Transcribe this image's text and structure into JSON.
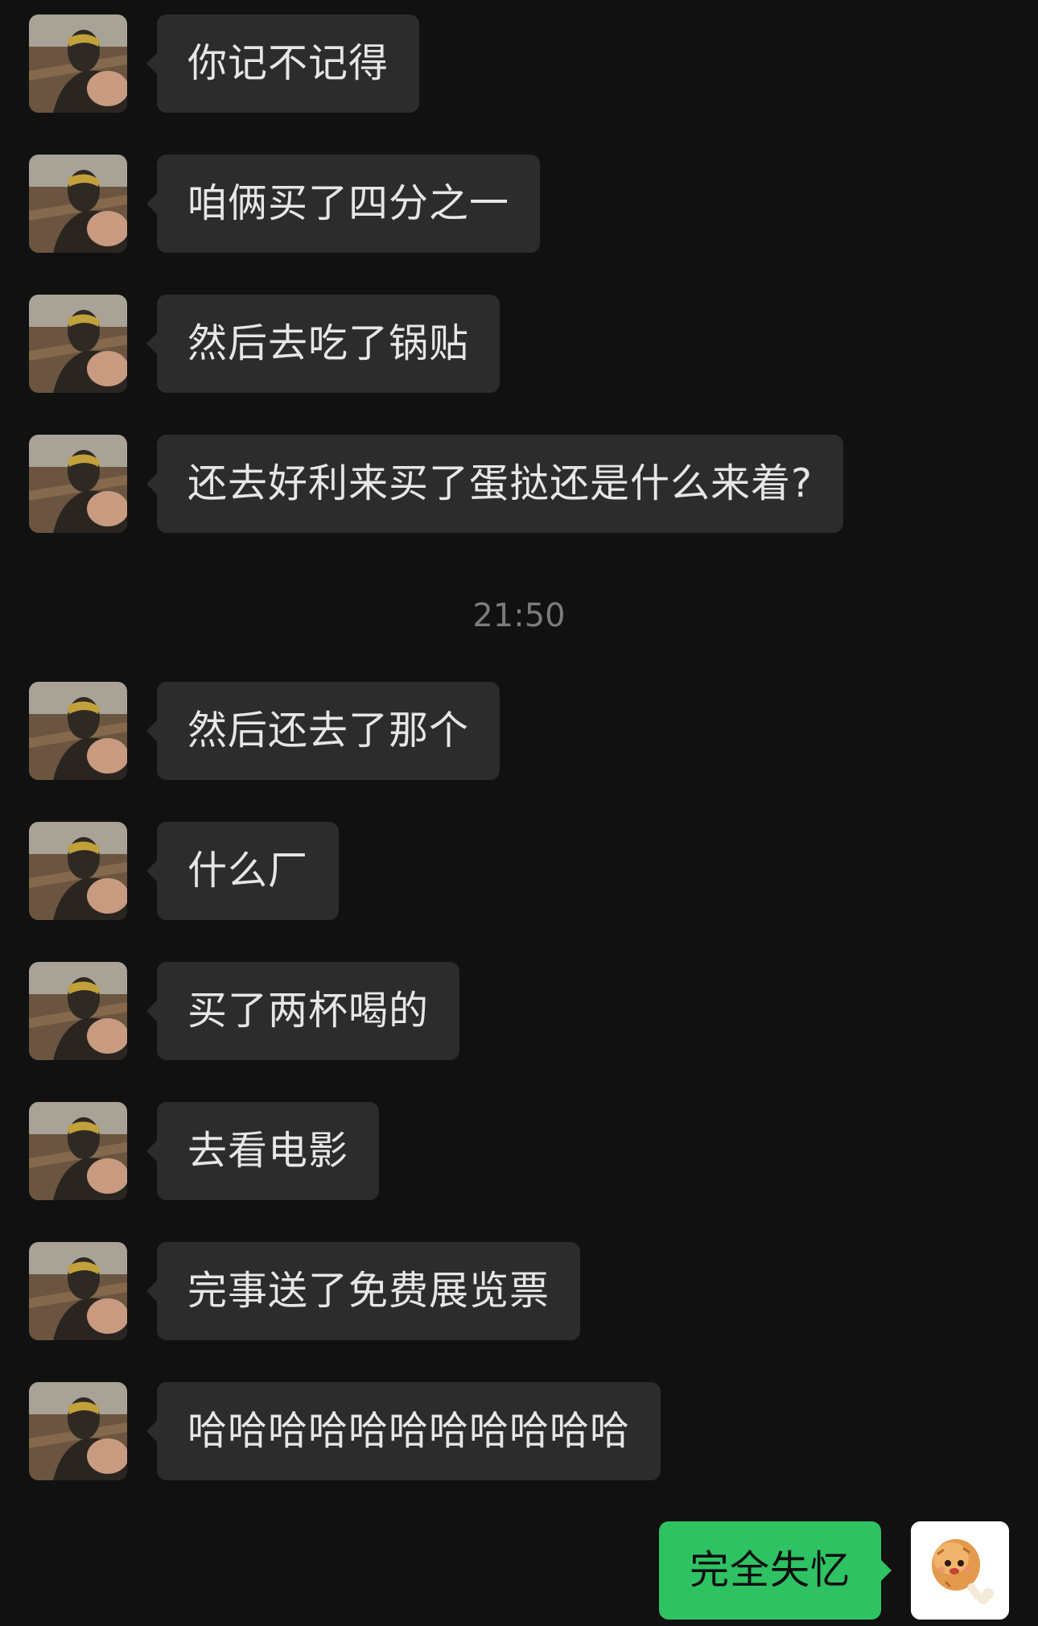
{
  "incoming_messages": [
    {
      "text": "你记不记得",
      "avatar": "profile-photo-icon"
    },
    {
      "text": "咱俩买了四分之一",
      "avatar": "profile-photo-icon"
    },
    {
      "text": "然后去吃了锅贴",
      "avatar": "profile-photo-icon"
    },
    {
      "text": "还去好利来买了蛋挞还是什么来着?",
      "avatar": "profile-photo-icon"
    }
  ],
  "timestamp": "21:50",
  "incoming_messages_after": [
    {
      "text": "然后还去了那个",
      "avatar": "profile-photo-icon"
    },
    {
      "text": "什么厂",
      "avatar": "profile-photo-icon"
    },
    {
      "text": "买了两杯喝的",
      "avatar": "profile-photo-icon"
    },
    {
      "text": "去看电影",
      "avatar": "profile-photo-icon"
    },
    {
      "text": "完事送了免费展览票",
      "avatar": "profile-photo-icon"
    },
    {
      "text": "哈哈哈哈哈哈哈哈哈哈哈",
      "avatar": "profile-photo-icon"
    }
  ],
  "outgoing_message": {
    "text": "完全失忆",
    "avatar": "chicken-leg-icon"
  },
  "colors": {
    "background": "#111111",
    "incoming_bubble": "#2c2c2c",
    "outgoing_bubble": "#2ec263",
    "incoming_text": "#e6e6e6",
    "timestamp_text": "#7b7b7b"
  }
}
